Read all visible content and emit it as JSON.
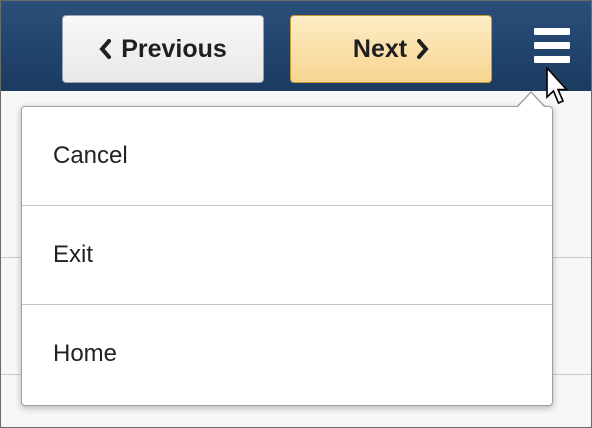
{
  "toolbar": {
    "previous_label": "Previous",
    "next_label": "Next",
    "previous_icon": "chevron-left-icon",
    "next_icon": "chevron-right-icon",
    "menu_icon": "hamburger-menu-icon"
  },
  "actions_menu": {
    "items": [
      {
        "label": "Cancel"
      },
      {
        "label": "Exit"
      },
      {
        "label": "Home"
      }
    ]
  },
  "colors": {
    "banner": "#21446d",
    "previous_button": "#eeeeee",
    "next_button": "#f9dfa4",
    "menu_background": "#ffffff",
    "separator": "#c4c4c4"
  }
}
